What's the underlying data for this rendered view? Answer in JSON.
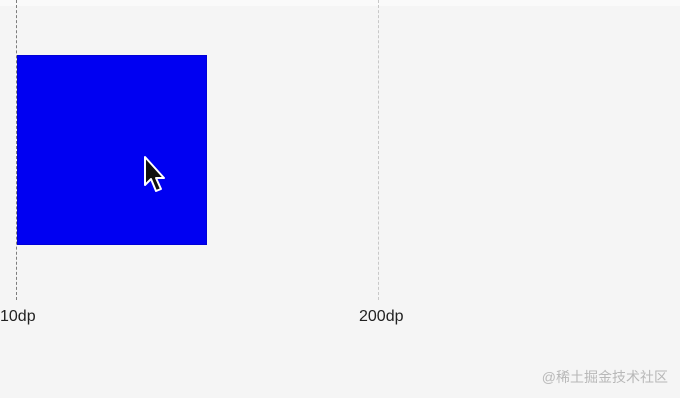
{
  "guides": {
    "left_label": "10dp",
    "right_label": "200dp"
  },
  "square": {
    "color": "#0000f2"
  },
  "cursor": {
    "icon": "mouse-pointer-icon"
  },
  "watermark": {
    "text": "@稀土掘金技术社区"
  }
}
